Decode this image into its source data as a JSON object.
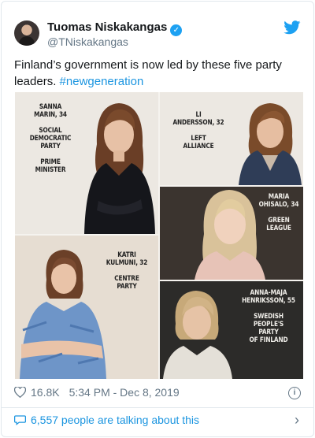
{
  "author": {
    "name": "Tuomas Niskakangas",
    "handle": "@TNiskakangas"
  },
  "tweet": {
    "text": "Finland’s government is now led by these five party leaders.",
    "hashtag": "#newgeneration"
  },
  "image": {
    "panels": [
      {
        "caption": "SANNA\nMARIN, 34\n\nSOCIAL\nDEMOCRATIC\nPARTY\n\nPRIME\nMINISTER"
      },
      {
        "caption": "LI\nANDERSSON, 32\n\nLEFT\nALLIANCE"
      },
      {
        "caption": "MARIA\nOHISALO, 34\n\nGREEN\nLEAGUE"
      },
      {
        "caption": "KATRI\nKULMUNI, 32\n\nCENTRE\nPARTY"
      },
      {
        "caption": "ANNA-MAJA\nHENRIKSSON, 55\n\nSWEDISH\nPEOPLE'S\nPARTY\nOF FINLAND"
      }
    ]
  },
  "meta": {
    "likes": "16.8K",
    "timestamp": "5:34 PM - Dec 8, 2019"
  },
  "engagement": {
    "talking": "6,557 people are talking about this"
  },
  "icons": {
    "brand": "twitter-bird-icon",
    "verified": "verified-badge-icon",
    "like": "heart-icon",
    "info": "info-icon",
    "reply": "speech-bubble-icon",
    "chevron": "chevron-right-icon"
  },
  "colors": {
    "link": "#1b95e0",
    "brand": "#1da1f2",
    "muted": "#657786"
  }
}
